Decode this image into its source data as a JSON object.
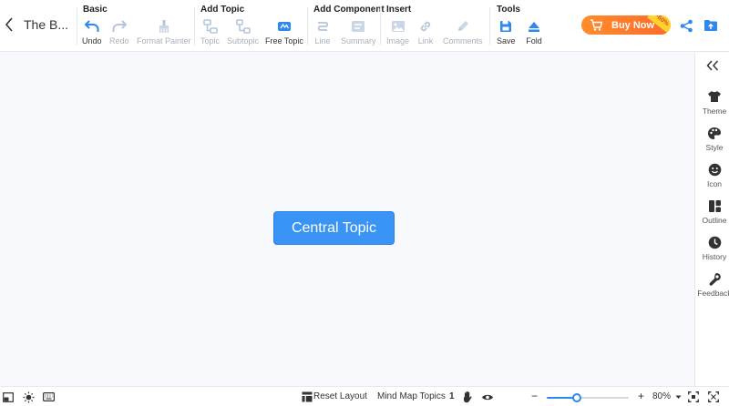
{
  "header": {
    "title": "The B..."
  },
  "toolbar": {
    "groups": [
      {
        "title": "Basic",
        "buttons": [
          {
            "label": "Undo",
            "icon": "undo-icon",
            "enabled": true
          },
          {
            "label": "Redo",
            "icon": "redo-icon",
            "enabled": false
          },
          {
            "label": "Format Painter",
            "icon": "format-painter-icon",
            "enabled": false
          }
        ]
      },
      {
        "title": "Add Topic",
        "buttons": [
          {
            "label": "Topic",
            "icon": "topic-icon",
            "enabled": false
          },
          {
            "label": "Subtopic",
            "icon": "subtopic-icon",
            "enabled": false
          },
          {
            "label": "Free Topic",
            "icon": "free-topic-icon",
            "enabled": true
          }
        ]
      },
      {
        "title": "Add Component",
        "buttons": [
          {
            "label": "Line",
            "icon": "line-icon",
            "enabled": false
          },
          {
            "label": "Summary",
            "icon": "summary-icon",
            "enabled": false
          }
        ]
      },
      {
        "title": "Insert",
        "buttons": [
          {
            "label": "Image",
            "icon": "image-icon",
            "enabled": false
          },
          {
            "label": "Link",
            "icon": "link-icon",
            "enabled": false
          },
          {
            "label": "Comments",
            "icon": "comments-icon",
            "enabled": false
          }
        ]
      },
      {
        "title": "Tools",
        "buttons": [
          {
            "label": "Save",
            "icon": "save-icon",
            "enabled": true
          },
          {
            "label": "Fold",
            "icon": "fold-icon",
            "enabled": true
          }
        ]
      }
    ],
    "buy": {
      "label": "Buy Now",
      "badge": "-60%"
    }
  },
  "canvas": {
    "central_topic": "Central Topic"
  },
  "right_panel": {
    "items": [
      {
        "label": "Theme",
        "icon": "shirt-icon"
      },
      {
        "label": "Style",
        "icon": "palette-icon"
      },
      {
        "label": "Icon",
        "icon": "smiley-icon"
      },
      {
        "label": "Outline",
        "icon": "outline-icon"
      },
      {
        "label": "History",
        "icon": "clock-icon"
      },
      {
        "label": "Feedback",
        "icon": "wrench-icon"
      }
    ]
  },
  "statusbar": {
    "reset_layout": "Reset Layout",
    "topics_label": "Mind Map Topics",
    "topics_count": "1",
    "zoom_minus": "−",
    "zoom_plus": "+",
    "zoom_level": "80%",
    "zoom_fraction": 0.37
  },
  "colors": {
    "accent": "#3a94f6",
    "icon_active": "#2f88f0",
    "icon_disabled": "#b4c6dc",
    "buy_gradient_start": "#ff8c2b",
    "buy_gradient_end": "#ff6a2b",
    "canvas_bg": "#f7f9fc"
  }
}
